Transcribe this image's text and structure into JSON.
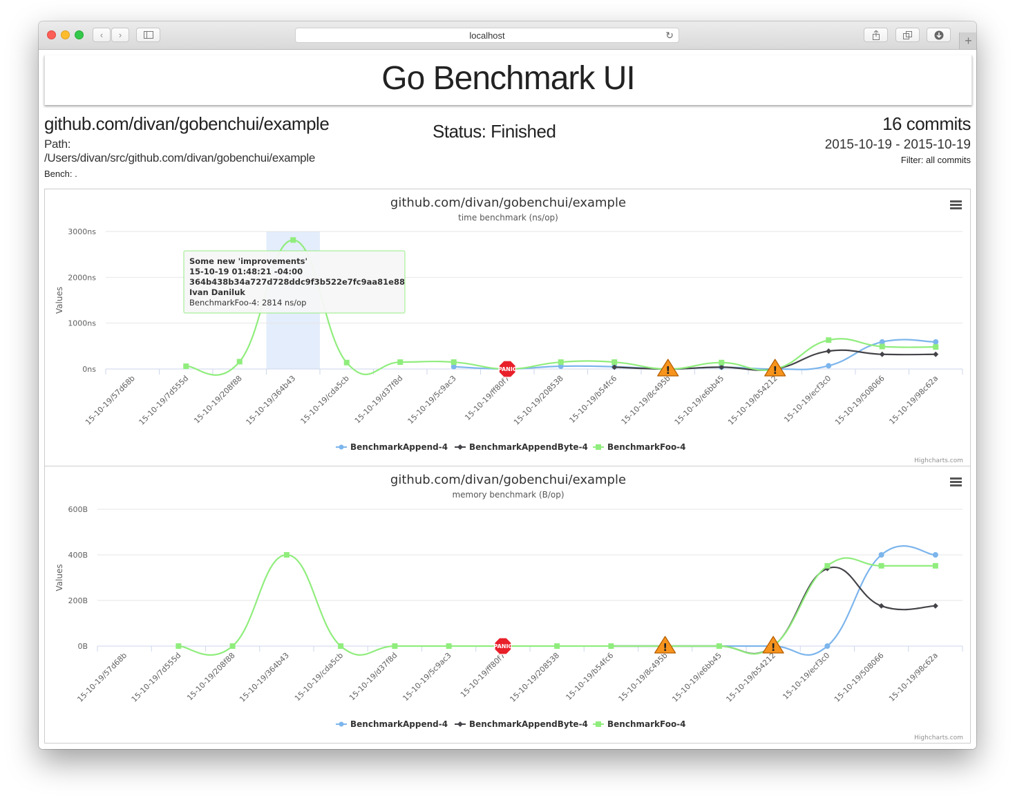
{
  "browser": {
    "url": "localhost",
    "reload_icon": "reload-icon",
    "new_tab_label": "+"
  },
  "page": {
    "app_title": "Go Benchmark UI",
    "package": "github.com/divan/gobenchui/example",
    "path_label": "Path:",
    "path_value": "/Users/divan/src/github.com/divan/gobenchui/example",
    "bench": "Bench: .",
    "status": "Status: Finished",
    "commits": "16 commits",
    "date_range": "2015-10-19 - 2015-10-19",
    "filter": "Filter: all commits"
  },
  "colors": {
    "append": "#7cb5ec",
    "appendbyte": "#434348",
    "foo": "#90ed7d",
    "highlight": "#d7e6f9"
  },
  "tooltip": {
    "lines": [
      "Some new 'improvements'",
      "15-10-19 01:48:21 -04:00",
      "364b438b34a727d728ddc9f3b522e7fc9aa81e88",
      "Ivan Daniluk",
      "BenchmarkFoo-4: 2814 ns/op"
    ]
  },
  "chart_data": [
    {
      "type": "line",
      "title": "github.com/divan/gobenchui/example",
      "subtitle": "time benchmark (ns/op)",
      "ylabel": "Values",
      "yunit": "ns",
      "ylim": [
        0,
        3000
      ],
      "yticks": [
        "0ns",
        "1000ns",
        "2000ns",
        "3000ns"
      ],
      "categories": [
        "15-10-19/57d68b",
        "15-10-19/7d555d",
        "15-10-19/208f88",
        "15-10-19/364b43",
        "15-10-19/cda5cb",
        "15-10-19/d37f8d",
        "15-10-19/5c9ac3",
        "15-10-19/ff80f7",
        "15-10-19/208538",
        "15-10-19/b54fc6",
        "15-10-19/8c495b",
        "15-10-19/e6bb45",
        "15-10-19/b54212",
        "15-10-19/ecf3c0",
        "15-10-19/508066",
        "15-10-19/98c62a"
      ],
      "series": [
        {
          "name": "BenchmarkAppend-4",
          "values": [
            null,
            null,
            null,
            null,
            null,
            null,
            50,
            0,
            60,
            50,
            0,
            40,
            0,
            70,
            590,
            590
          ]
        },
        {
          "name": "BenchmarkAppendByte-4",
          "values": [
            null,
            null,
            null,
            null,
            null,
            null,
            null,
            0,
            null,
            40,
            0,
            40,
            0,
            390,
            320,
            320
          ]
        },
        {
          "name": "BenchmarkFoo-4",
          "values": [
            null,
            60,
            160,
            2814,
            140,
            150,
            150,
            0,
            150,
            150,
            0,
            140,
            0,
            630,
            490,
            480
          ]
        }
      ],
      "markers": [
        {
          "category": "15-10-19/ff80f7",
          "label": "PANIC"
        },
        {
          "category": "15-10-19/8c495b",
          "label": "!"
        },
        {
          "category": "15-10-19/b54212",
          "label": "!"
        }
      ],
      "highlight_category": "15-10-19/364b43",
      "menu_icon": "hamburger-menu-icon",
      "credits": "Highcharts.com"
    },
    {
      "type": "line",
      "title": "github.com/divan/gobenchui/example",
      "subtitle": "memory benchmark (B/op)",
      "ylabel": "Values",
      "yunit": "B",
      "ylim": [
        0,
        600
      ],
      "yticks": [
        "0B",
        "200B",
        "400B",
        "600B"
      ],
      "categories": [
        "15-10-19/57d68b",
        "15-10-19/7d555d",
        "15-10-19/208f88",
        "15-10-19/364b43",
        "15-10-19/cda5cb",
        "15-10-19/d37f8d",
        "15-10-19/5c9ac3",
        "15-10-19/ff80f7",
        "15-10-19/208538",
        "15-10-19/b54fc6",
        "15-10-19/8c495b",
        "15-10-19/e6bb45",
        "15-10-19/b54212",
        "15-10-19/ecf3c0",
        "15-10-19/508066",
        "15-10-19/98c62a"
      ],
      "series": [
        {
          "name": "BenchmarkAppend-4",
          "values": [
            null,
            null,
            null,
            null,
            null,
            null,
            null,
            0,
            null,
            0,
            0,
            0,
            0,
            0,
            400,
            400
          ]
        },
        {
          "name": "BenchmarkAppendByte-4",
          "values": [
            null,
            null,
            null,
            null,
            null,
            null,
            null,
            0,
            null,
            0,
            0,
            0,
            0,
            340,
            176,
            176
          ]
        },
        {
          "name": "BenchmarkFoo-4",
          "values": [
            null,
            0,
            0,
            400,
            0,
            0,
            0,
            0,
            0,
            0,
            0,
            0,
            0,
            352,
            352,
            352
          ]
        }
      ],
      "markers": [
        {
          "category": "15-10-19/ff80f7",
          "label": "PANIC"
        },
        {
          "category": "15-10-19/8c495b",
          "label": "!"
        },
        {
          "category": "15-10-19/b54212",
          "label": "!"
        }
      ],
      "menu_icon": "hamburger-menu-icon",
      "credits": "Highcharts.com"
    }
  ]
}
